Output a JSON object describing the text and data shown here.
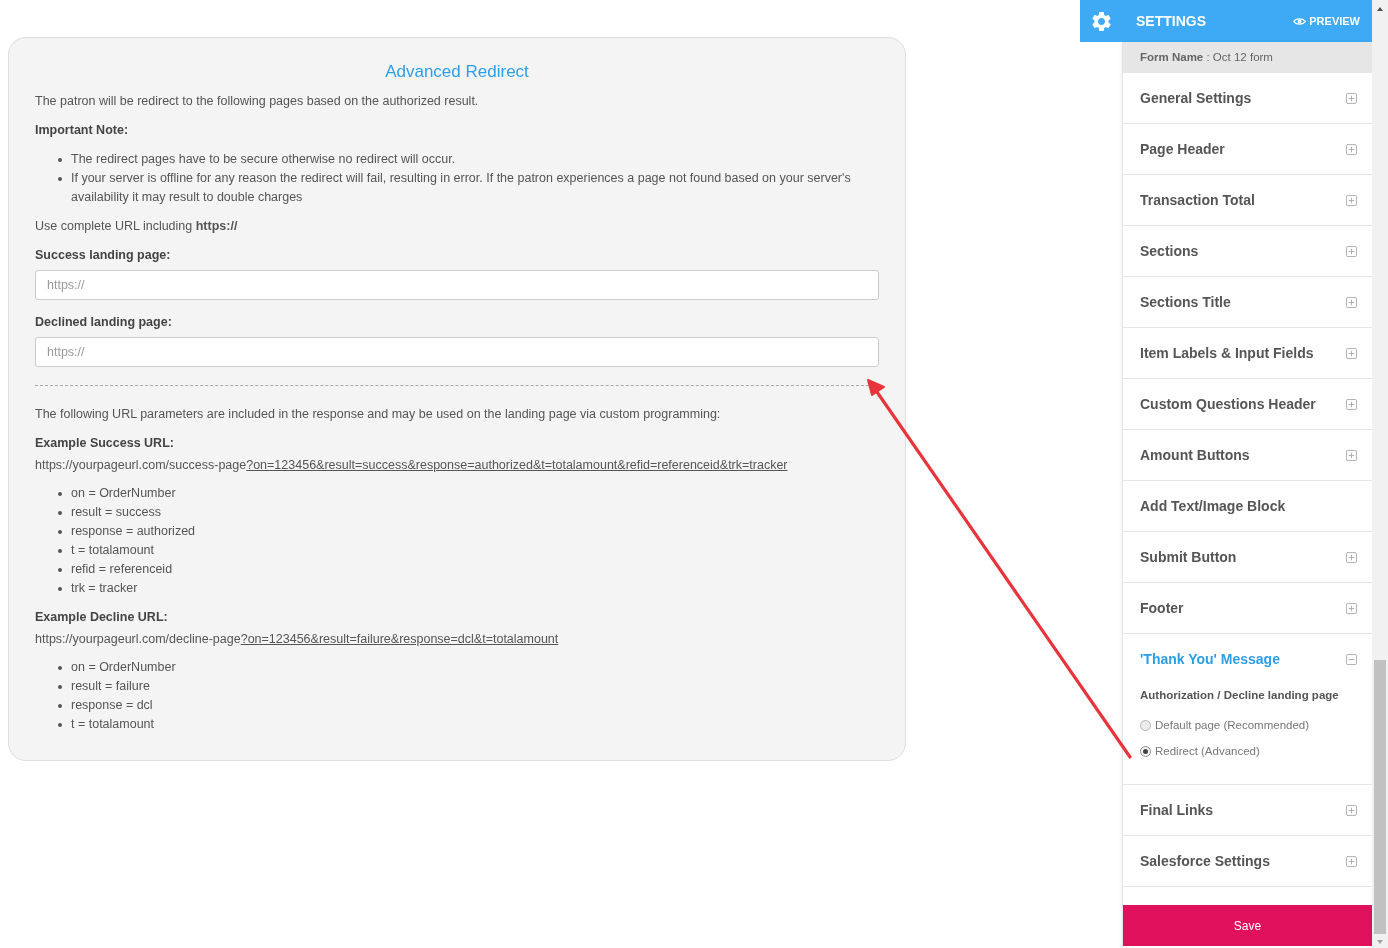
{
  "redirect_panel": {
    "title": "Advanced Redirect",
    "intro": "The patron will be redirect to the following pages based on the authorized result.",
    "note_heading": "Important Note:",
    "notes": [
      "The redirect pages have to be secure otherwise no redirect will occur.",
      "If your server is offline for any reason the redirect will fail, resulting in error. If the patron experiences a page not found based on your server's availability it may result to double charges"
    ],
    "url_hint": "Use complete URL including **https://**",
    "fields": [
      {
        "label": "Success landing page:",
        "placeholder": "https://"
      },
      {
        "label": "Declined landing page:",
        "placeholder": "https://"
      }
    ],
    "params_intro": "The following URL parameters are included in the response and may be used on the landing page via custom programming:",
    "examples": [
      {
        "heading": "Example Success URL:",
        "url_base": "https://yourpageurl.com/success-page",
        "url_query": "?on=123456&result=success&response=authorized&t=totalamount&refid=referenceid&trk=tracker",
        "params": [
          "on = OrderNumber",
          "result = success",
          "response = authorized",
          "t = totalamount",
          "refid = referenceid",
          "trk = tracker"
        ]
      },
      {
        "heading": "Example Decline URL:",
        "url_base": "https://yourpageurl.com/decline-page",
        "url_query": "?on=123456&result=failure&response=dcl&t=totalamount",
        "params": [
          "on = OrderNumber",
          "result = failure",
          "response = dcl",
          "t = totalamount"
        ]
      }
    ]
  },
  "settings_panel": {
    "title": "SETTINGS",
    "preview": "PREVIEW",
    "form_name": "**Form Name** : Oct 12 form",
    "sections": [
      {
        "label": "General Settings",
        "toggle": true,
        "expanded": false
      },
      {
        "label": "Page Header",
        "toggle": true,
        "expanded": false
      },
      {
        "label": "Transaction Total",
        "toggle": true,
        "expanded": false
      },
      {
        "label": "Sections",
        "toggle": true,
        "expanded": false
      },
      {
        "label": "Sections Title",
        "toggle": true,
        "expanded": false
      },
      {
        "label": "Item Labels & Input Fields",
        "toggle": true,
        "expanded": false
      },
      {
        "label": "Custom Questions Header",
        "toggle": true,
        "expanded": false
      },
      {
        "label": "Amount Buttons",
        "toggle": true,
        "expanded": false
      },
      {
        "label": "Add Text/Image Block",
        "toggle": false,
        "expanded": false
      },
      {
        "label": "Submit Button",
        "toggle": true,
        "expanded": false
      },
      {
        "label": "Footer",
        "toggle": true,
        "expanded": false
      },
      {
        "label": "'Thank You' Message",
        "toggle": true,
        "expanded": true,
        "heading": "Authorization / Decline landing page",
        "options": [
          {
            "label": "Default page (Recommended)",
            "selected": false
          },
          {
            "label": "Redirect (Advanced)",
            "selected": true
          }
        ]
      },
      {
        "label": "Final Links",
        "toggle": true,
        "expanded": false
      },
      {
        "label": "Salesforce Settings",
        "toggle": true,
        "expanded": false
      }
    ],
    "save": "Save"
  }
}
